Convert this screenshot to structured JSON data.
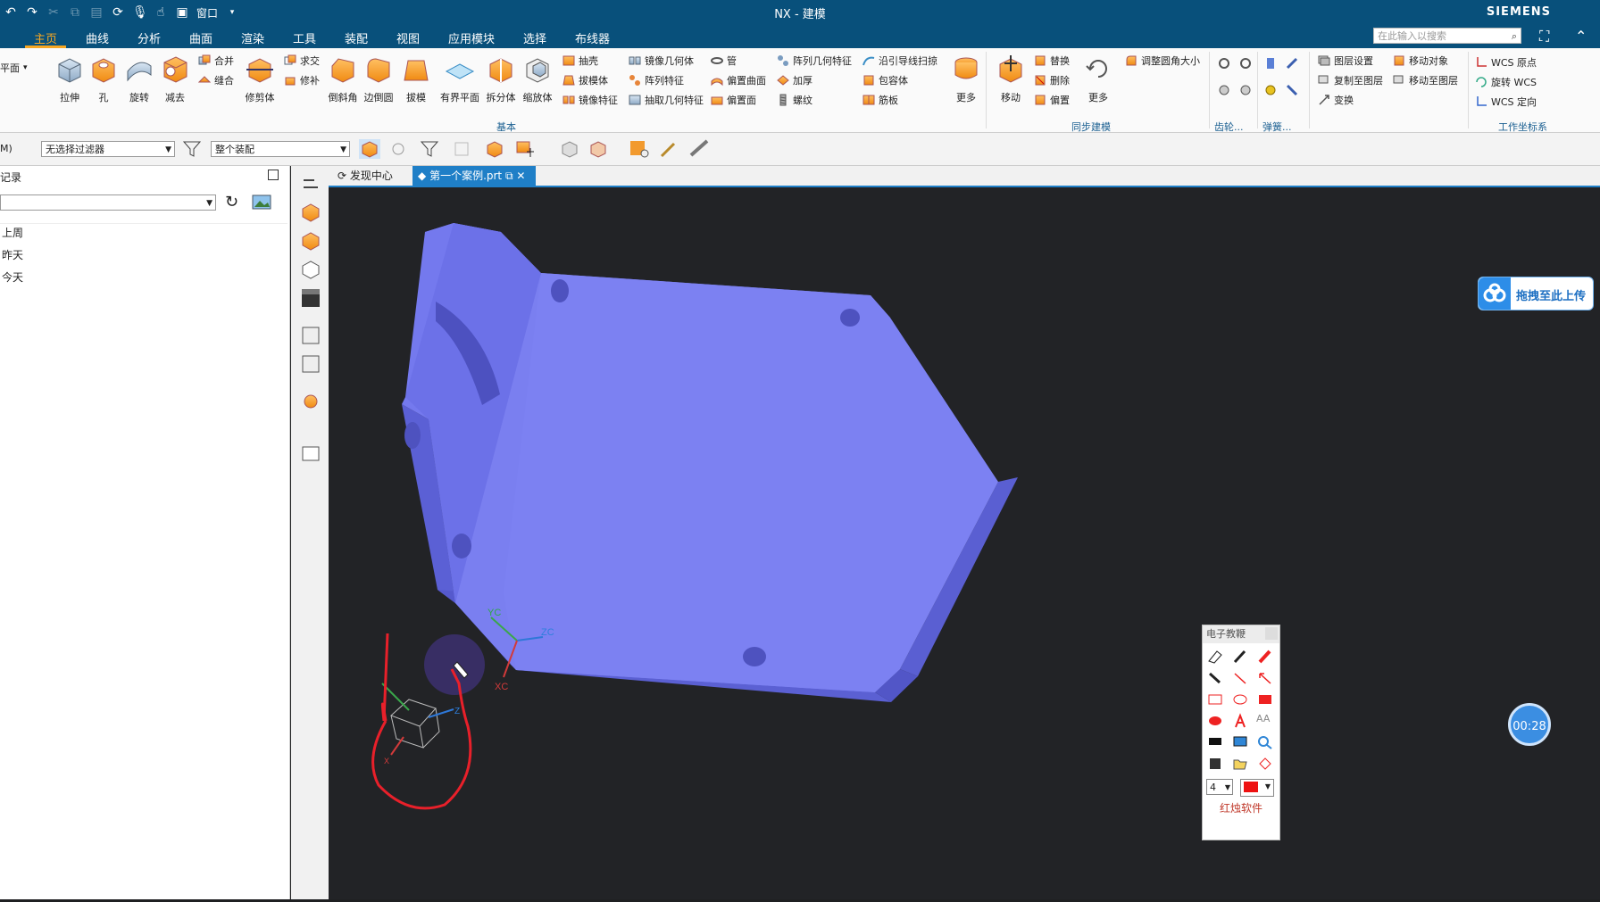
{
  "window": {
    "title": "NX - 建模",
    "brand": "SIEMENS",
    "window_menu": "窗口"
  },
  "menu": {
    "tabs": [
      "主页",
      "曲线",
      "分析",
      "曲面",
      "渲染",
      "工具",
      "装配",
      "视图",
      "应用模块",
      "选择",
      "布线器"
    ],
    "active": 0,
    "search_placeholder": "在此输入以搜索"
  },
  "ribbon": {
    "plane_label": "平面",
    "big_buttons": [
      "拉伸",
      "孔",
      "旋转",
      "减去",
      "修剪体",
      "倒斜角",
      "边倒圆",
      "拔模",
      "有界平面",
      "拆分体",
      "缩放体"
    ],
    "col_union": [
      "合并",
      "缝合"
    ],
    "col_intersect": [
      "求交",
      "修补"
    ],
    "col_shell": [
      "抽壳",
      "拔模体",
      "镜像特征"
    ],
    "col_mirror_geom": [
      "镜像几何体",
      "阵列特征",
      "抽取几何特征"
    ],
    "col_tube": [
      "管",
      "偏置曲面",
      "偏置面"
    ],
    "col_pattern_geom": [
      "阵列几何特征",
      "加厚",
      "螺纹"
    ],
    "col_sweep": [
      "沿引导线扫掠",
      "包容体",
      "筋板"
    ],
    "more_label": "更多",
    "group_basic": "基本",
    "move_label": "移动",
    "col_replace": [
      "替换",
      "删除",
      "偏置"
    ],
    "more2_label": "更多",
    "resize_blend": "调整圆角大小",
    "group_sync": "同步建模",
    "group_gear": "齿轮...",
    "group_spring": "弹簧...",
    "col_layers": [
      "图层设置",
      "复制至图层",
      "变换"
    ],
    "col_move": [
      "移动对象",
      "移动至图层"
    ],
    "col_wcs": [
      "WCS 原点",
      "旋转 WCS",
      "WCS 定向"
    ],
    "group_wcs": "工作坐标系"
  },
  "toolbar2": {
    "menu_label": "M)",
    "filter_value": "无选择过滤器",
    "assembly_value": "整个装配"
  },
  "left_panel": {
    "title": "记录",
    "items": [
      "上周",
      "昨天",
      "今天"
    ]
  },
  "doc_tabs": [
    {
      "label": "发现中心",
      "active": false
    },
    {
      "label": "第一个案例.prt",
      "active": true
    }
  ],
  "axes": {
    "yc": "YC",
    "zc": "ZC",
    "xc": "XC",
    "triad_z": "Z",
    "triad_x": "X"
  },
  "palette": {
    "title": "电子教鞭",
    "size_value": "4",
    "brand": "红烛软件",
    "text_tool": "AA"
  },
  "upload": {
    "label": "拖拽至此上传"
  },
  "timer": {
    "value": "00:28"
  },
  "colors": {
    "titlebar": "#08507b",
    "accent": "#f6a622",
    "part": "#7a7ff0",
    "viewport": "#222326"
  }
}
